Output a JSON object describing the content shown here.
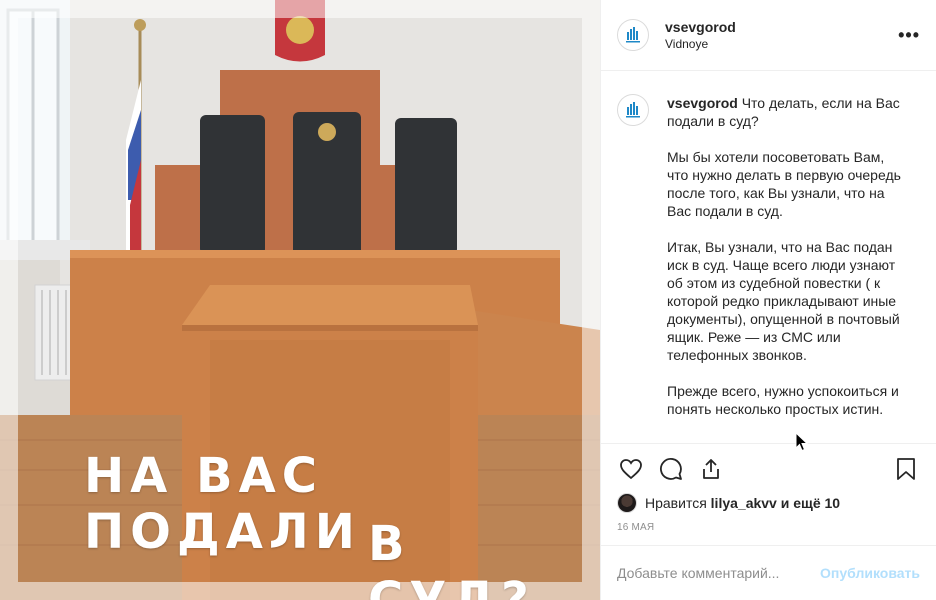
{
  "post": {
    "image": {
      "overlay_line1": "НА ВАС ПОДАЛИ",
      "overlay_line2": "В СУД?"
    },
    "header": {
      "username": "vsevgorod",
      "location": "Vidnoye",
      "more_icon": "more-horizontal-icon"
    },
    "caption": {
      "username": "vsevgorod",
      "paragraphs": [
        "Что делать, если на Вас подали в суд?",
        "Мы бы хотели посоветовать Вам, что нужно делать в первую очередь после того, как Вы узнали, что на Вас подали в суд.",
        "Итак, Вы узнали, что на Вас подан иск в суд. Чаще всего люди узнают об этом из судебной повестки ( к которой редко прикладывают иные документы), опущенной в почтовый ящик. Реже — из СМС или телефонных звонков.",
        "Прежде всего, нужно успокоиться и понять несколько простых истин."
      ]
    },
    "actions": {
      "icons": [
        "heart-icon",
        "comment-icon",
        "share-icon",
        "bookmark-icon"
      ],
      "likes_prefix": "Нравится",
      "likes_user": "lilya_akvv",
      "likes_suffix": "и ещё 10",
      "date": "16 МАЯ"
    },
    "add_comment": {
      "placeholder": "Добавьте комментарий...",
      "publish_label": "Опубликовать"
    },
    "colors": {
      "text": "#262626",
      "secondary": "#8e8e8e",
      "border": "#efefef",
      "publish_disabled": "#b2dffc",
      "wood": "#c8773a"
    }
  }
}
